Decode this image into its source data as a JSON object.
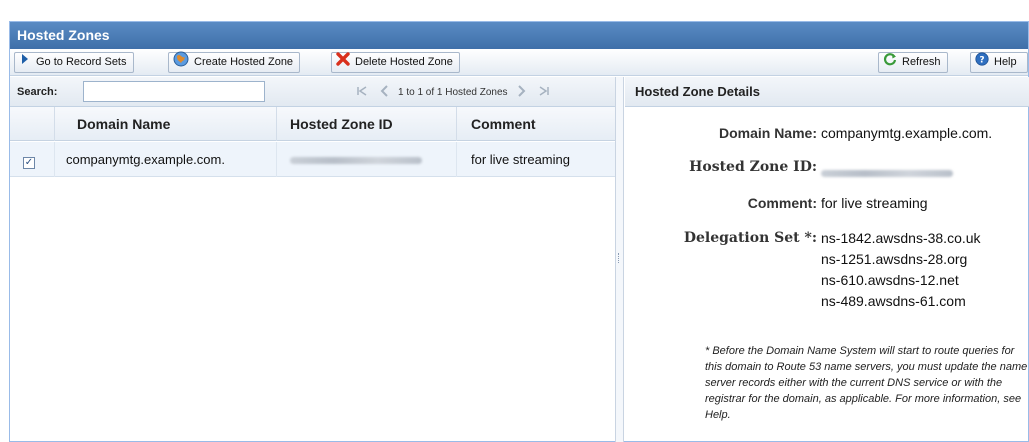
{
  "panel": {
    "title": "Hosted Zones"
  },
  "toolbar": {
    "go_to_record_sets": "Go to Record Sets",
    "create_hosted_zone": "Create Hosted Zone",
    "delete_hosted_zone": "Delete Hosted Zone",
    "refresh": "Refresh",
    "help": "Help"
  },
  "search": {
    "label": "Search:",
    "value": ""
  },
  "pager": {
    "text": "1 to 1 of 1 Hosted Zones"
  },
  "grid": {
    "columns": [
      "Domain Name",
      "Hosted Zone ID",
      "Comment"
    ],
    "rows": [
      {
        "checked": true,
        "domain": "companymtg.example.com.",
        "zone_id": "(redacted)",
        "comment": "for live streaming"
      }
    ]
  },
  "details": {
    "title": "Hosted Zone Details",
    "domain_label": "Domain Name:",
    "domain_value": "companymtg.example.com.",
    "zone_id_label": "Hosted Zone ID:",
    "comment_label": "Comment:",
    "comment_value": "for live streaming",
    "delegation_label": "Delegation Set *:",
    "name_servers": [
      "ns-1842.awsdns-38.co.uk",
      "ns-1251.awsdns-28.org",
      "ns-610.awsdns-12.net",
      "ns-489.awsdns-61.com"
    ],
    "footnote": "* Before the Domain Name System will start to route queries for this domain to Route 53 name servers, you must update the name server records either with the current DNS service or with the registrar for the domain, as applicable. For more information, see Help."
  },
  "colors": {
    "title_bar": "#4a7ab8",
    "accent": "#1f5fa8",
    "delete": "#d9301c",
    "refresh": "#3a9a3a"
  }
}
